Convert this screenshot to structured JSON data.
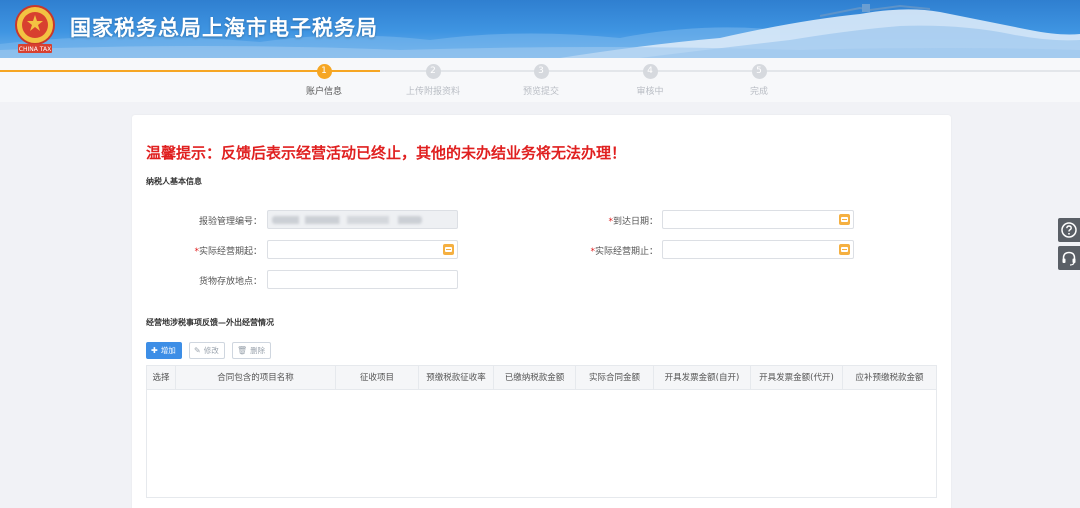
{
  "header": {
    "site_title": "国家税务总局上海市电子税务局",
    "logo_caption": "CHINA TAX",
    "brand_color": "#3a8fe0"
  },
  "stepper": {
    "steps": [
      {
        "number": "1",
        "label": "账户信息",
        "state": "active"
      },
      {
        "number": "2",
        "label": "上传附报资料",
        "state": "pending"
      },
      {
        "number": "3",
        "label": "预览提交",
        "state": "pending"
      },
      {
        "number": "4",
        "label": "审核中",
        "state": "pending"
      },
      {
        "number": "5",
        "label": "完成",
        "state": "pending"
      }
    ],
    "active_color": "#f6a623"
  },
  "form": {
    "warning": "温馨提示：反馈后表示经营活动已终止，其他的未办结业务将无法办理！",
    "basic_info_title": "纳税人基本信息",
    "fields": {
      "report_no": {
        "label": "报验管理编号："
      },
      "arrival_date": {
        "required_mark": "*",
        "label": "到达日期：",
        "value": ""
      },
      "start_date": {
        "required_mark": "*",
        "label": "实际经营期起：",
        "value": ""
      },
      "end_date": {
        "required_mark": "*",
        "label": "实际经营期止：",
        "value": ""
      },
      "storage_location": {
        "label": "货物存放地点：",
        "value": ""
      }
    },
    "required_color": "#e02020"
  },
  "feedback_section": {
    "title": "经营地涉税事项反馈—外出经营情况",
    "toolbar": {
      "add_label": "增加",
      "edit_label": "修改",
      "delete_label": "删除"
    },
    "table": {
      "columns": [
        "选择",
        "合同包含的项目名称",
        "征收项目",
        "预缴税款征收率",
        "已缴纳税款金额",
        "实际合同金额",
        "开具发票金额(自开)",
        "开具发票金额(代开)",
        "应补预缴税款金额"
      ],
      "rows": []
    }
  },
  "side_tools": {
    "help_icon": "question-circle-icon",
    "support_icon": "headset-icon"
  }
}
